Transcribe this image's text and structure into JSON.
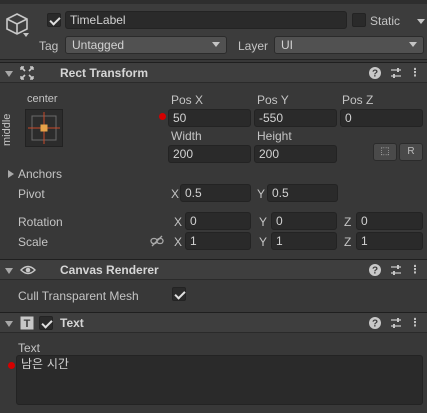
{
  "gameobject": {
    "name": "TimeLabel",
    "active": true,
    "static_label": "Static",
    "static_checked": false,
    "tag_label": "Tag",
    "tag_value": "Untagged",
    "layer_label": "Layer",
    "layer_value": "UI"
  },
  "rect_transform": {
    "title": "Rect Transform",
    "anchor_preset_top": "center",
    "anchor_preset_side": "middle",
    "pos_x_label": "Pos X",
    "pos_y_label": "Pos Y",
    "pos_z_label": "Pos Z",
    "pos_x": "50",
    "pos_y": "-550",
    "pos_z": "0",
    "width_label": "Width",
    "height_label": "Height",
    "width": "200",
    "height": "200",
    "blueprint_btn": "⬚",
    "raw_btn": "R",
    "anchors_label": "Anchors",
    "pivot_label": "Pivot",
    "pivot_x_axis": "X",
    "pivot_x": "0.5",
    "pivot_y_axis": "Y",
    "pivot_y": "0.5",
    "rotation_label": "Rotation",
    "rot_x_axis": "X",
    "rot_x": "0",
    "rot_y_axis": "Y",
    "rot_y": "0",
    "rot_z_axis": "Z",
    "rot_z": "0",
    "scale_label": "Scale",
    "scale_x_axis": "X",
    "scale_x": "1",
    "scale_y_axis": "Y",
    "scale_y": "1",
    "scale_z_axis": "Z",
    "scale_z": "1"
  },
  "canvas_renderer": {
    "title": "Canvas Renderer",
    "cull_label": "Cull Transparent Mesh",
    "cull_checked": true
  },
  "text_component": {
    "title": "Text",
    "enabled": true,
    "text_label": "Text",
    "text_value": "남은 시간"
  },
  "header_icons": {
    "help": "?",
    "presets": "≡",
    "menu": "⋮"
  },
  "colors": {
    "background": "#383838",
    "field": "#2a2a2a",
    "override_dot": "#d40000"
  }
}
